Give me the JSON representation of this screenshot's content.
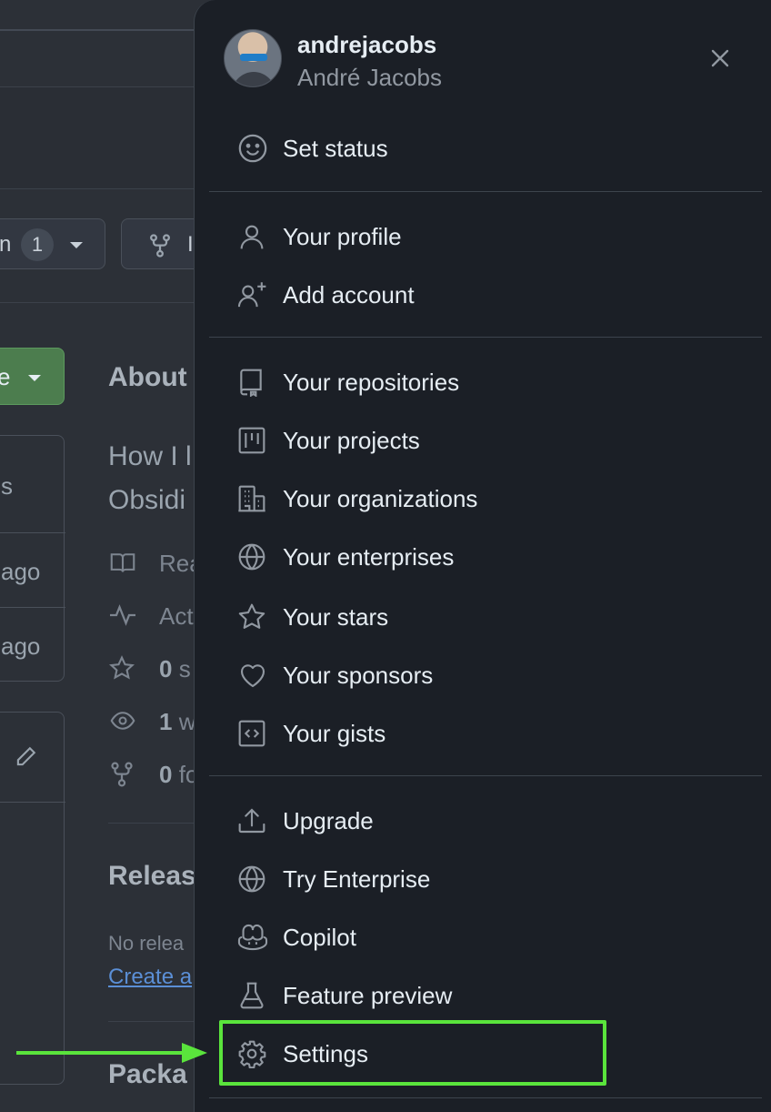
{
  "background": {
    "watch_label": "n",
    "watch_count": "1",
    "fork_label": "I",
    "code_label": "e",
    "about_title": "About",
    "description_lines": [
      "How I l",
      "Obsidi"
    ],
    "files": [
      "s",
      "ago",
      "ago"
    ],
    "meta": [
      {
        "icon": "book-icon",
        "text": "Rea"
      },
      {
        "icon": "pulse-icon",
        "text": "Act"
      },
      {
        "icon": "star-icon",
        "bold": "0",
        "text": " s"
      },
      {
        "icon": "eye-icon",
        "bold": "1",
        "text": " w"
      },
      {
        "icon": "fork-icon",
        "bold": "0",
        "text": " fo"
      }
    ],
    "releases_title": "Releas",
    "no_releases": "No relea",
    "create_link": "Create a",
    "packages_title": "Packa"
  },
  "user": {
    "username": "andrejacobs",
    "fullname": "André Jacobs"
  },
  "menu": {
    "set_status": "Set status",
    "your_profile": "Your profile",
    "add_account": "Add account",
    "your_repositories": "Your repositories",
    "your_projects": "Your projects",
    "your_organizations": "Your organizations",
    "your_enterprises": "Your enterprises",
    "your_stars": "Your stars",
    "your_sponsors": "Your sponsors",
    "your_gists": "Your gists",
    "upgrade": "Upgrade",
    "try_enterprise": "Try Enterprise",
    "copilot": "Copilot",
    "feature_preview": "Feature preview",
    "settings": "Settings"
  },
  "colors": {
    "panel_bg": "#1b1f26",
    "highlight": "#5ae43c",
    "text": "#e6edf3",
    "muted": "#9198a1"
  }
}
